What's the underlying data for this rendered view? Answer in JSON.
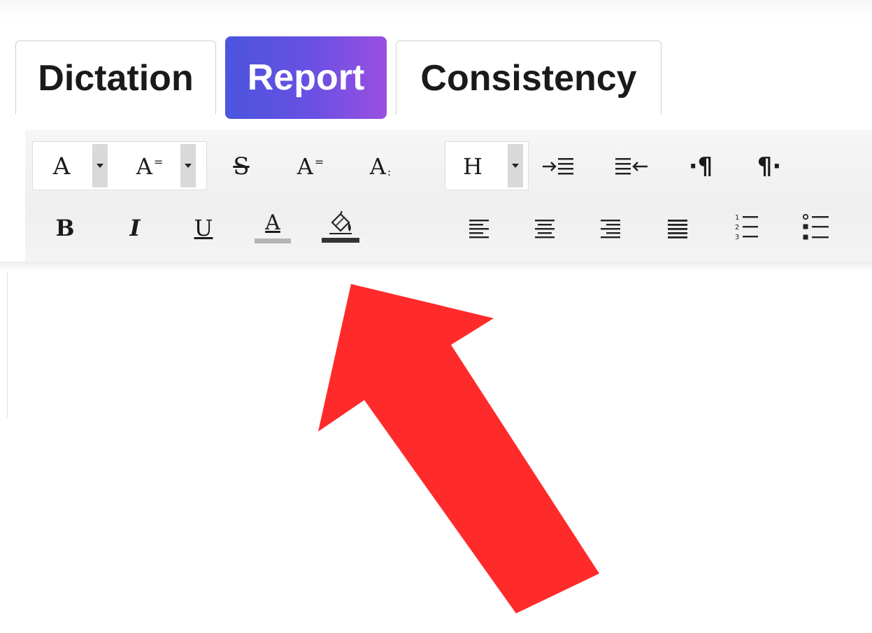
{
  "tabs": [
    {
      "label": "Dictation",
      "active": false
    },
    {
      "label": "Report",
      "active": true
    },
    {
      "label": "Consistency",
      "active": false
    }
  ],
  "toolbar": {
    "row1": {
      "font": {
        "icon": "font-icon",
        "glyph": "A"
      },
      "font_size": {
        "icon": "font-size-icon",
        "glyph": "A"
      },
      "strikethrough": {
        "icon": "strikethrough-icon",
        "glyph": "S"
      },
      "superscript": {
        "icon": "superscript-icon",
        "glyph": "A"
      },
      "subscript": {
        "icon": "subscript-icon",
        "glyph": "A"
      },
      "heading": {
        "icon": "heading-icon",
        "glyph": "H"
      },
      "indent": {
        "icon": "indent-icon"
      },
      "outdent": {
        "icon": "outdent-icon"
      },
      "ltr_paragraph": {
        "icon": "ltr-paragraph-icon",
        "glyph": "·¶"
      },
      "rtl_paragraph": {
        "icon": "rtl-paragraph-icon",
        "glyph": "¶·"
      }
    },
    "row2": {
      "bold": {
        "icon": "bold-icon",
        "glyph": "B"
      },
      "italic": {
        "icon": "italic-icon",
        "glyph": "I"
      },
      "underline": {
        "icon": "underline-icon",
        "glyph": "U"
      },
      "text_color": {
        "icon": "text-color-icon",
        "glyph": "A",
        "swatch": "#b5b5b5"
      },
      "highlight": {
        "icon": "paint-bucket-icon",
        "swatch": "#333333"
      },
      "align_left": {
        "icon": "align-left-icon"
      },
      "align_center": {
        "icon": "align-center-icon"
      },
      "align_right": {
        "icon": "align-right-icon"
      },
      "justify": {
        "icon": "justify-icon"
      },
      "ordered_list": {
        "icon": "ordered-list-icon"
      },
      "bullet_list": {
        "icon": "bullet-list-icon"
      }
    }
  },
  "annotation": {
    "icon": "red-arrow-icon",
    "color": "#ff2a2a"
  },
  "colors": {
    "report_tab_gradient_start": "#4a55dd",
    "report_tab_gradient_end": "#9a4fe0",
    "toolbar_bg": "#f1f1f1"
  }
}
